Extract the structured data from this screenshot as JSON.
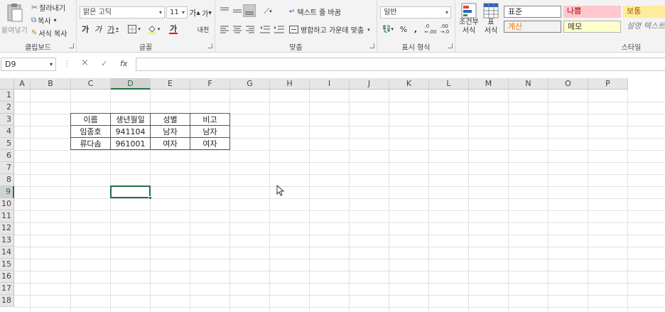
{
  "clipboard": {
    "paste_label": "붙여넣기",
    "cut_label": "잘라내기",
    "copy_label": "복사",
    "format_painter_label": "서식 복사",
    "group_label": "클립보드"
  },
  "font": {
    "font_name": "맑은 고딕",
    "font_size": "11",
    "grow_label": "가",
    "shrink_label": "가",
    "bold_label": "가",
    "italic_label": "가",
    "underline_label": "가",
    "font_color_label": "가",
    "phonetic_label": "내천",
    "group_label": "글꼴"
  },
  "alignment": {
    "wrap_text_label": "텍스트 줄 바꿈",
    "merge_center_label": "병합하고 가운데 맞춤",
    "group_label": "맞춤"
  },
  "number": {
    "format_value": "일반",
    "percent_label": "%",
    "comma_label": ",",
    "group_label": "표시 형식"
  },
  "styles": {
    "conditional_label_1": "조건부",
    "conditional_label_2": "서식",
    "table_label_1": "표",
    "table_label_2": "서식",
    "normal": "표준",
    "bad": "나쁨",
    "neutral": "보통",
    "calculation": "계산",
    "note": "메모",
    "explanatory": "설명 텍스트",
    "group_label": "스타일",
    "colors": {
      "bad_bg": "#ffc7ce",
      "bad_text": "#9c0006",
      "neutral_bg": "#ffeb9c",
      "neutral_text": "#9c5700",
      "calc_bg": "#f2f2f2",
      "calc_text": "#fa7d00",
      "note_bg": "#ffffcc"
    }
  },
  "formula_bar": {
    "name_box": "D9",
    "cancel_icon": "×",
    "enter_icon": "✓",
    "fx_label": "fx",
    "content": ""
  },
  "sheet": {
    "columns": [
      "A",
      "B",
      "C",
      "D",
      "E",
      "F",
      "G",
      "H",
      "I",
      "J",
      "K",
      "L",
      "M",
      "N",
      "O",
      "P"
    ],
    "rows": [
      "1",
      "2",
      "3",
      "4",
      "5",
      "6",
      "7",
      "8",
      "9",
      "10",
      "11",
      "12",
      "13",
      "14",
      "15",
      "16",
      "17",
      "18"
    ],
    "selected_cell": "D9",
    "accent_color": "#217346",
    "table": {
      "headers": [
        "이름",
        "생년월일",
        "성별",
        "비고"
      ],
      "data": [
        [
          "임종호",
          "941104",
          "남자",
          "남자"
        ],
        [
          "류다솜",
          "961001",
          "여자",
          "여자"
        ]
      ]
    }
  }
}
